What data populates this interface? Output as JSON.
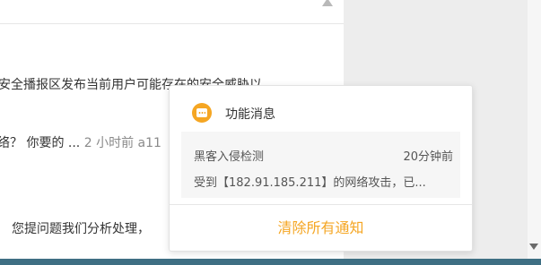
{
  "background": {
    "line1": "安全播报区发布当前用户可能存在的安全威胁以",
    "line2_question": "络？ 你要的 ...",
    "line2_meta": "2 小时前 a11",
    "line3": "您提问题我们分析处理，"
  },
  "popup": {
    "title": "功能消息",
    "notice": {
      "title": "黑客入侵检测",
      "time": "20分钟前",
      "body": "受到【182.91.185.211】的网络攻击，已..."
    },
    "clear_label": "清除所有通知",
    "accent_color": "#f5a623"
  },
  "icons": [
    "scroll-up-icon",
    "message-icon",
    "scroll-down-icon"
  ]
}
